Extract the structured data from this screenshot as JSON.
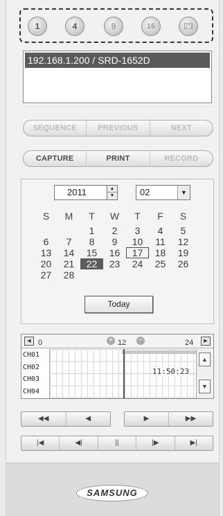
{
  "split": {
    "btn_1": "1",
    "btn_4": "4",
    "btn_9": "9",
    "btn_16": "16",
    "fullscreen_icon": "fullscreen-icon"
  },
  "camera_list": {
    "selected": "192.168.1.200   / SRD-1652D"
  },
  "sequence_bar": {
    "sequence": "SEQUENCE",
    "previous": "PREVIOUS",
    "next": "NEXT"
  },
  "capture_bar": {
    "capture": "CAPTURE",
    "print": "PRINT",
    "record": "RECORD"
  },
  "calendar": {
    "year": "2011",
    "month": "02",
    "weekdays": [
      "S",
      "M",
      "T",
      "W",
      "T",
      "F",
      "S"
    ],
    "days": [
      [
        "",
        "",
        "1",
        "2",
        "3",
        "4",
        "5"
      ],
      [
        "6",
        "7",
        "8",
        "9",
        "10",
        "11",
        "12"
      ],
      [
        "13",
        "14",
        "15",
        "16",
        "17",
        "18",
        "19"
      ],
      [
        "20",
        "21",
        "22",
        "23",
        "24",
        "25",
        "26"
      ],
      [
        "27",
        "28",
        "",
        "",
        "",
        "",
        ""
      ]
    ],
    "selected_day": "22",
    "marked_day": "17",
    "today_label": "Today"
  },
  "timeline": {
    "start": "0",
    "middle": "12",
    "end": "24",
    "channels": [
      "CH01",
      "CH02",
      "CH03",
      "CH04"
    ],
    "cursor_time": "11:50:23"
  },
  "playback": {
    "fast_rewind": "◀◀",
    "rewind": "◀",
    "play": "▶",
    "fast_forward": "▶▶",
    "first": "|◀",
    "step_back": "◀|",
    "pause": "||",
    "step_forward": "|▶",
    "last": "▶|"
  },
  "footer": {
    "logo": "SAMSUNG"
  }
}
